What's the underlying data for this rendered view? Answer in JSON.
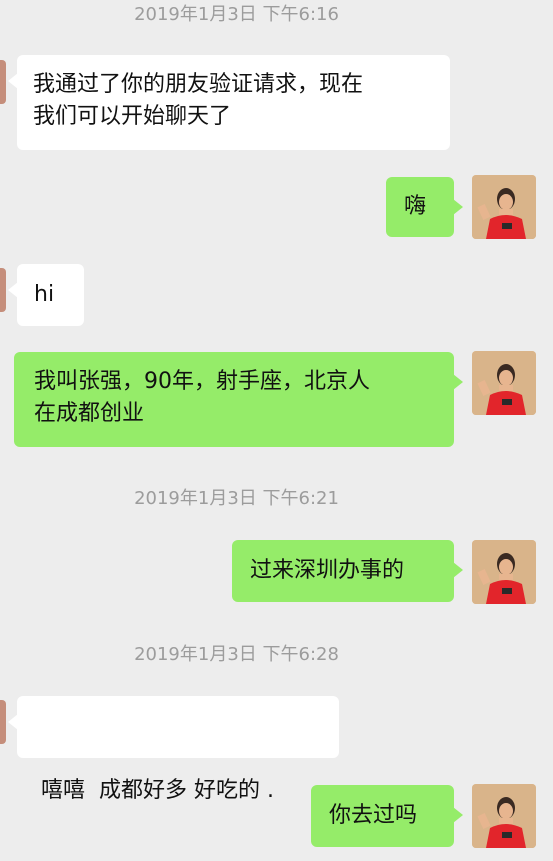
{
  "chat": {
    "timestamps": [
      "2019年1月3日 下午6:16",
      "2019年1月3日 下午6:21",
      "2019年1月3日 下午6:28"
    ],
    "messages": [
      {
        "side": "in",
        "lines": [
          "我通过了你的朋友验证请求，现在",
          "我们可以开始聊天了"
        ]
      },
      {
        "side": "out",
        "lines": [
          "嗨"
        ]
      },
      {
        "side": "in",
        "lines": [
          "hi"
        ]
      },
      {
        "side": "out",
        "lines": [
          "我叫张强，90年，射手座，北京人",
          "在成都创业"
        ]
      },
      {
        "side": "out",
        "lines": [
          "过来深圳办事的"
        ]
      },
      {
        "side": "in",
        "lines": [
          "嘻嘻  成都好多 好吃的 ."
        ]
      },
      {
        "side": "out",
        "lines": [
          "你去过吗"
        ]
      }
    ]
  },
  "colors": {
    "background": "#ededed",
    "incoming_bubble": "#ffffff",
    "outgoing_bubble": "#95ec69",
    "timestamp_text": "#9c9c9c"
  },
  "icons": {
    "self_avatar": "user-avatar-photo"
  }
}
